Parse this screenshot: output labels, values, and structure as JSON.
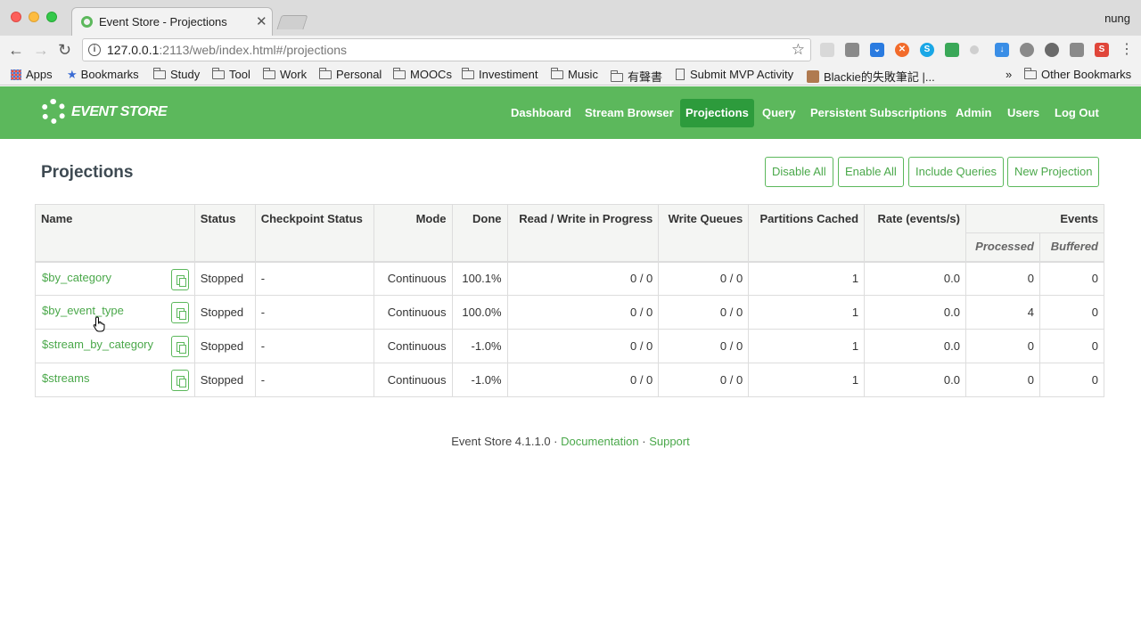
{
  "browser": {
    "tab_title": "Event Store - Projections",
    "profile": "nung",
    "url_host": "127.0.0.1",
    "url_rest": ":2113/web/index.html#/projections",
    "bookmarks": [
      {
        "label": "Apps",
        "icon": "apps-icon"
      },
      {
        "label": "Bookmarks",
        "icon": "star-icon"
      },
      {
        "label": "Study",
        "icon": "folder-icon"
      },
      {
        "label": "Tool",
        "icon": "folder-icon"
      },
      {
        "label": "Work",
        "icon": "folder-icon"
      },
      {
        "label": "Personal",
        "icon": "folder-icon"
      },
      {
        "label": "MOOCs",
        "icon": "folder-icon"
      },
      {
        "label": "Investiment",
        "icon": "folder-icon"
      },
      {
        "label": "Music",
        "icon": "folder-icon"
      },
      {
        "label": "有聲書",
        "icon": "folder-icon"
      },
      {
        "label": "Submit MVP Activity",
        "icon": "page-icon"
      },
      {
        "label": "Blackie的失敗筆記 |...",
        "icon": "avatar-icon"
      }
    ],
    "more_bookmarks": "»",
    "other_bookmarks": "Other Bookmarks"
  },
  "app": {
    "logo_text": "EVENT STORE",
    "nav": {
      "dashboard": "Dashboard",
      "stream_browser": "Stream Browser",
      "projections": "Projections",
      "query": "Query",
      "persistent_subscriptions": "Persistent Subscriptions",
      "admin": "Admin",
      "users": "Users",
      "logout": "Log Out"
    },
    "accent_color": "#5cb85c",
    "active_nav_color": "#2d9b3c"
  },
  "page": {
    "title": "Projections",
    "actions": {
      "disable_all": "Disable All",
      "enable_all": "Enable All",
      "include_queries": "Include Queries",
      "new_projection": "New Projection"
    }
  },
  "table": {
    "headers": {
      "name": "Name",
      "status": "Status",
      "checkpoint_status": "Checkpoint Status",
      "mode": "Mode",
      "done": "Done",
      "read_write": "Read / Write in Progress",
      "write_queues": "Write Queues",
      "partitions_cached": "Partitions Cached",
      "rate": "Rate (events/s)",
      "events": "Events",
      "processed": "Processed",
      "buffered": "Buffered"
    },
    "rows": [
      {
        "name": "$by_category",
        "status": "Stopped",
        "checkpoint": "-",
        "mode": "Continuous",
        "done": "100.1%",
        "rw": "0 / 0",
        "queues": "0 / 0",
        "partitions": "1",
        "rate": "0.0",
        "processed": "0",
        "buffered": "0"
      },
      {
        "name": "$by_event_type",
        "status": "Stopped",
        "checkpoint": "-",
        "mode": "Continuous",
        "done": "100.0%",
        "rw": "0 / 0",
        "queues": "0 / 0",
        "partitions": "1",
        "rate": "0.0",
        "processed": "4",
        "buffered": "0"
      },
      {
        "name": "$stream_by_category",
        "status": "Stopped",
        "checkpoint": "-",
        "mode": "Continuous",
        "done": "-1.0%",
        "rw": "0 / 0",
        "queues": "0 / 0",
        "partitions": "1",
        "rate": "0.0",
        "processed": "0",
        "buffered": "0"
      },
      {
        "name": "$streams",
        "status": "Stopped",
        "checkpoint": "-",
        "mode": "Continuous",
        "done": "-1.0%",
        "rw": "0 / 0",
        "queues": "0 / 0",
        "partitions": "1",
        "rate": "0.0",
        "processed": "0",
        "buffered": "0"
      }
    ]
  },
  "footer": {
    "version": "Event Store 4.1.1.0",
    "sep": "·",
    "documentation": "Documentation",
    "support": "Support"
  }
}
